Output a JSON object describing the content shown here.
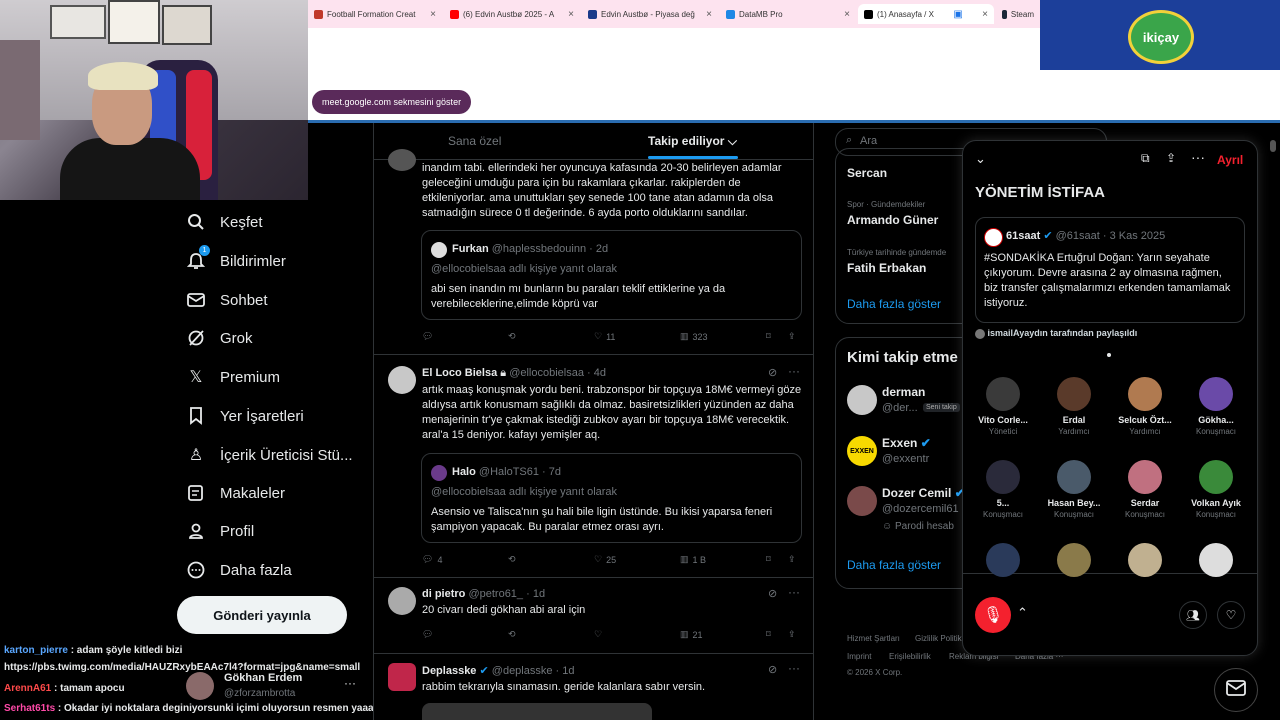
{
  "browser": {
    "tabs": [
      {
        "label": "Football Formation Creat",
        "color": "#c0392b"
      },
      {
        "label": "(6) Edvin Austbø 2025 - A",
        "color": "#ff0000"
      },
      {
        "label": "Edvin Austbø - Piyasa değ",
        "color": "#1a3a8a"
      },
      {
        "label": "DataMB Pro",
        "color": "#1e88e5"
      },
      {
        "label": "(1) Anasayfa / X",
        "color": "#000000"
      },
      {
        "label": "Steam",
        "color": "#1b2838"
      }
    ],
    "meet_notice": "meet.google.com sekmesini göster"
  },
  "sponsor": {
    "logo_text": "ikiçay"
  },
  "nav": {
    "items": [
      {
        "label": "Keşfet",
        "icon": "search-icon"
      },
      {
        "label": "Bildirimler",
        "icon": "bell-icon",
        "badge": "1"
      },
      {
        "label": "Sohbet",
        "icon": "mail-icon"
      },
      {
        "label": "Grok",
        "icon": "grok-icon"
      },
      {
        "label": "Premium",
        "icon": "x-icon"
      },
      {
        "label": "Yer İşaretleri",
        "icon": "bookmark-icon"
      },
      {
        "label": "İçerik Üreticisi Stü...",
        "icon": "creator-icon"
      },
      {
        "label": "Makaleler",
        "icon": "article-icon"
      },
      {
        "label": "Profil",
        "icon": "profile-icon"
      },
      {
        "label": "Daha fazla",
        "icon": "more-icon"
      }
    ],
    "post_button": "Gönderi yayınla",
    "account": {
      "name": "Gökhan Erdem",
      "handle": "@zforzambrotta"
    }
  },
  "chat": [
    {
      "user": "karton_pierre",
      "text": " : adam şöyle kitledi bizi",
      "color": "#5aa7ff"
    },
    {
      "user": "",
      "text": "https://pbs.twimg.com/media/HAUZRxybEAAc7l4?format=jpg&name=small",
      "color": "#ffffff"
    },
    {
      "user": "ArennA61",
      "text": " : tamam apocu",
      "color": "#ff4a4a"
    },
    {
      "user": "Serhat61ts",
      "text": " : Okadar iyi noktalara deginiyorsunki içimi oluyorsun resmen yaaa",
      "color": "#ff4aa8"
    }
  ],
  "feed": {
    "tabs": [
      "Sana özel",
      "Takip ediliyor"
    ],
    "posts": [
      {
        "text": "inandım tabi. ellerindeki her oyuncuya kafasında 20-30 belirleyen adamlar geleceğini umduğu para için bu rakamlara çıkarlar. rakiplerden de etkileniyorlar. ama unuttukları şey senede 100 tane atan adamın da olsa satmadığın sürece 0 tl değerinde. 6 ayda porto olduklarını sandılar.",
        "quote": {
          "name": "Furkan",
          "handle": "@haplessbedouinn · 2d",
          "reply": "@ellocobielsaa adlı kişiye yanıt olarak",
          "text": "abi sen inandın mı bunların bu paraları teklif ettiklerine ya da verebileceklerine,elimde köprü var"
        },
        "stats": {
          "replies": "",
          "reposts": "",
          "likes": "11",
          "views": "323"
        }
      },
      {
        "name": "El Loco Bielsa",
        "handle": "@ellocobielsaa · 4d",
        "text": "artık maaş konuşmak yordu beni. trabzonspor bir topçuya 18M€ vermeyi göze aldıysa artık konusmam sağlıklı da olmaz. basiretsizlikleri yüzünden az daha menajerinin tr'ye çakmak istediği zubkov ayarı bir topçuya 18M€ verecektik. aral'a 15 deniyor. kafayı yemişler aq.",
        "quote": {
          "name": "Halo",
          "handle": "@HaloTS61 · 7d",
          "reply": "@ellocobielsaa adlı kişiye yanıt olarak",
          "text": "Asensio ve Talisca'nın şu hali bile ligin üstünde. Bu ikisi yaparsa feneri şampiyon yapacak. Bu paralar etmez orası ayrı."
        },
        "stats": {
          "replies": "4",
          "reposts": "",
          "likes": "25",
          "views": "1 B"
        }
      },
      {
        "name": "di pietro",
        "handle": "@petro61_ · 1d",
        "text": "20 civarı dedi gökhan abi aral için",
        "stats": {
          "replies": "",
          "reposts": "",
          "likes": "",
          "views": "21"
        }
      },
      {
        "name": "Deplasske",
        "handle": "@deplasske · 1d",
        "text": "rabbim tekrarıyla sınamasın. geride kalanlara sabır versin."
      }
    ]
  },
  "right": {
    "search_placeholder": "Ara",
    "trends": [
      {
        "context": "",
        "title": "Sercan"
      },
      {
        "context": "Spor · Gündemdekiler",
        "title": "Armando Güner"
      },
      {
        "context": "Türkiye tarihinde gündemde",
        "title": "Fatih Erbakan"
      }
    ],
    "show_more": "Daha fazla göster",
    "who_to_follow_title": "Kimi takip etme",
    "follow": [
      {
        "name": "derman",
        "handle": "@der...",
        "badge": "Seni takip"
      },
      {
        "name": "Exxen",
        "handle": "@exxentr",
        "badge": ""
      },
      {
        "name": "Dozer Cemil",
        "handle": "@dozercemil61",
        "badge": "Parodi hesab"
      }
    ],
    "show_more2": "Daha fazla göster",
    "footer": [
      "Hizmet Şartları",
      "Gizlilik Politik",
      "Imprint",
      "Erişilebilirlik",
      "Reklam bilgisi",
      "Daha fazla ···",
      "© 2026 X Corp."
    ]
  },
  "space": {
    "leave": "Ayrıl",
    "title": "YÖNETİM İSTİFAA",
    "pinned": {
      "name": "61saat",
      "handle": "@61saat · 3 Kas 2025",
      "text": "#SONDAKİKA Ertuğrul Doğan: Yarın seyahate çıkıyorum. Devre arasına 2 ay olmasına rağmen, biz transfer çalışmalarımızı erkenden tamamlamak istiyoruz."
    },
    "shared_by": "ismailAyaydın tarafından paylaşıldı",
    "speakers": [
      {
        "name": "Vito Corle...",
        "role": "Yönetici",
        "color": "#3a3a3a"
      },
      {
        "name": "Erdal",
        "role": "Yardımcı",
        "color": "#5a3a2a"
      },
      {
        "name": "Selcuk Özt...",
        "role": "Yardımcı",
        "color": "#b07a50"
      },
      {
        "name": "Gökha...",
        "role": "Konuşmacı",
        "color": "#6a4aa8"
      },
      {
        "name": "5...",
        "role": "Konuşmacı",
        "color": "#2a2a3a"
      },
      {
        "name": "Hasan Bey...",
        "role": "Konuşmacı",
        "color": "#4a5a6a"
      },
      {
        "name": "Serdar",
        "role": "Konuşmacı",
        "color": "#c07080"
      },
      {
        "name": "Volkan Ayık",
        "role": "Konuşmacı",
        "color": "#3a8a3a"
      },
      {
        "name": "",
        "role": "",
        "color": "#2a3a5a"
      },
      {
        "name": "",
        "role": "",
        "color": "#8a7a4a"
      },
      {
        "name": "",
        "role": "",
        "color": "#c0b090"
      },
      {
        "name": "",
        "role": "",
        "color": "#dddddd"
      }
    ]
  }
}
